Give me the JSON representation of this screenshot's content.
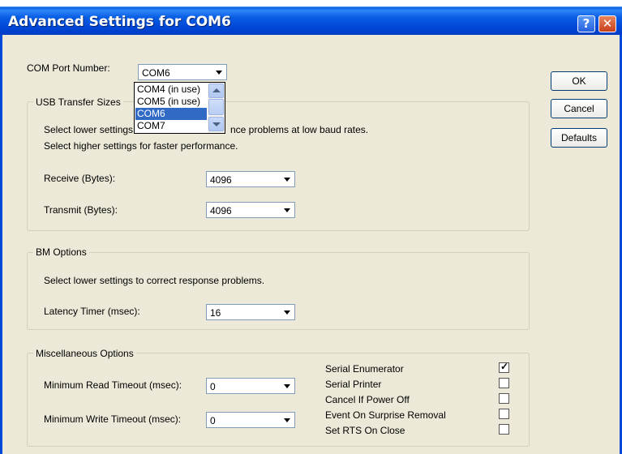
{
  "window": {
    "title": "Advanced Settings for COM6",
    "help_label": "?",
    "close_label": "✕"
  },
  "com_port": {
    "label": "COM Port Number:",
    "selected": "COM6",
    "options": [
      "COM4 (in use)",
      "COM5 (in use)",
      "COM6",
      "COM7"
    ]
  },
  "usb_transfer": {
    "title": "USB Transfer Sizes",
    "desc1_a": "Select lower settings",
    "desc1_b": "nce problems at low baud rates.",
    "desc2": "Select higher settings for faster performance.",
    "receive_label": "Receive (Bytes):",
    "receive_value": "4096",
    "transmit_label": "Transmit (Bytes):",
    "transmit_value": "4096"
  },
  "bm_options": {
    "title": "BM Options",
    "desc": "Select lower settings to correct response problems.",
    "latency_label": "Latency Timer (msec):",
    "latency_value": "16"
  },
  "misc": {
    "title": "Miscellaneous Options",
    "read_timeout_label": "Minimum Read Timeout (msec):",
    "read_timeout_value": "0",
    "write_timeout_label": "Minimum Write Timeout (msec):",
    "write_timeout_value": "0",
    "checkboxes": [
      {
        "label": "Serial Enumerator",
        "checked": true
      },
      {
        "label": "Serial Printer",
        "checked": false
      },
      {
        "label": "Cancel If Power Off",
        "checked": false
      },
      {
        "label": "Event On Surprise Removal",
        "checked": false
      },
      {
        "label": "Set RTS On Close",
        "checked": false
      }
    ],
    "check_mark": "✓"
  },
  "buttons": {
    "ok": "OK",
    "cancel": "Cancel",
    "defaults": "Defaults"
  },
  "colors": {
    "titlebar": "#0a5fe4",
    "dialog_bg": "#ece9d8",
    "selection": "#316ac5"
  }
}
